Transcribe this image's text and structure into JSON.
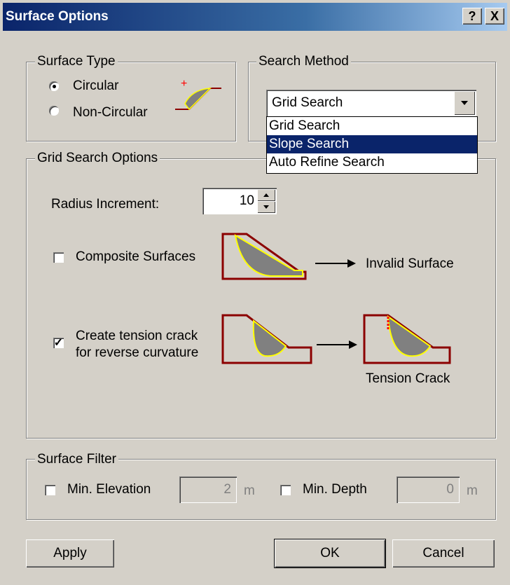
{
  "window": {
    "title": "Surface Options",
    "help_btn": "?",
    "close_btn": "X"
  },
  "surface_type": {
    "legend": "Surface Type",
    "options": [
      "Circular",
      "Non-Circular"
    ],
    "selected": "Circular"
  },
  "search_method": {
    "legend": "Search Method",
    "value": "Grid Search",
    "options": [
      "Grid Search",
      "Slope Search",
      "Auto Refine Search"
    ],
    "highlighted": "Slope Search"
  },
  "grid_options": {
    "legend": "Grid Search Options",
    "radius_label": "Radius Increment:",
    "radius_value": "10",
    "composite_label": "Composite Surfaces",
    "composite_checked": false,
    "invalid_label": "Invalid Surface",
    "tension_label_1": "Create tension crack",
    "tension_label_2": "for reverse curvature",
    "tension_checked": true,
    "tension_crack_label": "Tension Crack"
  },
  "surface_filter": {
    "legend": "Surface Filter",
    "min_elev_label": "Min. Elevation",
    "min_elev_value": "2",
    "min_elev_unit": "m",
    "min_depth_label": "Min. Depth",
    "min_depth_value": "0",
    "min_depth_unit": "m"
  },
  "buttons": {
    "apply": "Apply",
    "ok": "OK",
    "cancel": "Cancel"
  },
  "colors": {
    "title_bar": "#0a246a",
    "slope_outline": "#8b0000",
    "slip_fill": "#808080",
    "slip_edge": "#ffff00"
  }
}
